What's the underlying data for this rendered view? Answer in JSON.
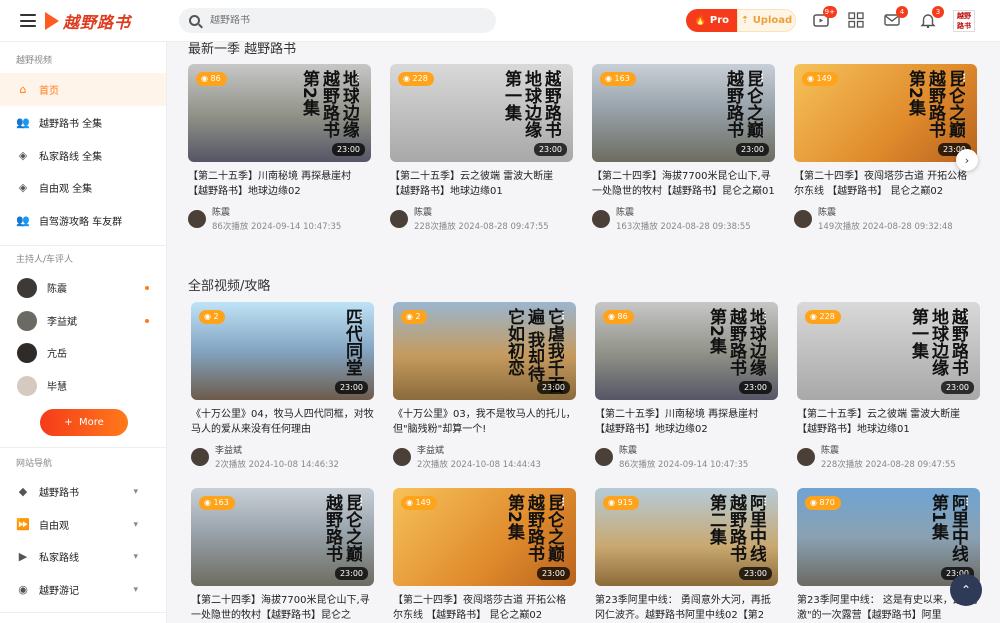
{
  "header": {
    "logo_text": "越野路书",
    "search_placeholder": "越野路书",
    "pro_label": "Pro",
    "upload_label": "Upload",
    "badges": {
      "video": "9+",
      "mail": "4",
      "bell": "3"
    },
    "avatar_text": "越野路书"
  },
  "sidebar": {
    "section1": "越野视频",
    "items": [
      {
        "label": "首页",
        "icon": "home-icon"
      },
      {
        "label": "越野路书 全集",
        "icon": "users-icon"
      },
      {
        "label": "私家路线 全集",
        "icon": "layers-icon"
      },
      {
        "label": "自由观 全集",
        "icon": "layers-icon"
      },
      {
        "label": "自驾游攻略 车友群",
        "icon": "users-icon"
      }
    ],
    "section2": "主持人/车评人",
    "hosts": [
      {
        "name": "陈震"
      },
      {
        "name": "李益斌"
      },
      {
        "name": "亢岳"
      },
      {
        "name": "毕慧"
      }
    ],
    "more_label": "More",
    "section3": "网站导航",
    "nav": [
      {
        "label": "越野路书",
        "icon": "diamond-icon"
      },
      {
        "label": "自由观",
        "icon": "forward-icon"
      },
      {
        "label": "私家路线",
        "icon": "video-icon"
      },
      {
        "label": "越野游记",
        "icon": "user-circle-icon"
      }
    ]
  },
  "main": {
    "latest_title": "最新一季 越野路书",
    "all_title": "全部视频/攻略",
    "latest": [
      {
        "title": "【第二十五季】川南秘境 再探悬崖村【越野路书】地球边缘02",
        "views": "86",
        "duration": "23:00",
        "author": "陈震",
        "stats": "86次播放 2024-09-14 10:47:35",
        "theme": "t-car",
        "overlay": "地球边缘 越野路书 第2集"
      },
      {
        "title": "【第二十五季】云之彼端 雷波大断崖【越野路书】地球边缘01",
        "views": "228",
        "duration": "23:00",
        "author": "陈震",
        "stats": "228次播放 2024-08-28 09:47:55",
        "theme": "t-grey",
        "overlay": "越野路书 地球边缘 第一集"
      },
      {
        "title": "【第二十四季】海拔7700米昆仑山下,寻一处隐世的牧村【越野路书】昆仑之巅01",
        "views": "163",
        "duration": "23:00",
        "author": "陈震",
        "stats": "163次播放 2024-08-28 09:38:55",
        "theme": "t-mtn",
        "overlay": "昆仑之巅 越野路书"
      },
      {
        "title": "【第二十四季】夜闯塔莎古道 开拓公格尔东线 【越野路书】 昆仑之巅02",
        "views": "149",
        "duration": "23:00",
        "author": "陈震",
        "stats": "149次播放 2024-08-28 09:32:48",
        "theme": "t-gold",
        "overlay": "昆仑之巅 越野路书 第2集"
      }
    ],
    "all_row1": [
      {
        "title": "《十万公里》04，牧马人四代同框，对牧马人的爱从来没有任何理由",
        "views": "2",
        "duration": "23:00",
        "author": "李益斌",
        "stats": "2次播放 2024-10-08 14:46:32",
        "theme": "t-jeep",
        "overlay": "四代同堂"
      },
      {
        "title": "《十万公里》03，我不是牧马人的托儿，但\"脑残粉\"却算一个!",
        "views": "2",
        "duration": "23:00",
        "author": "李益斌",
        "stats": "2次播放 2024-10-08 14:44:43",
        "theme": "t-desert",
        "overlay": "它虐我千百遍 我却待它如初恋"
      },
      {
        "title": "【第二十五季】川南秘境 再探悬崖村【越野路书】地球边缘02",
        "views": "86",
        "duration": "23:00",
        "author": "陈震",
        "stats": "86次播放 2024-09-14 10:47:35",
        "theme": "t-car",
        "overlay": "地球边缘 越野路书 第2集"
      },
      {
        "title": "【第二十五季】云之彼端 雷波大断崖【越野路书】地球边缘01",
        "views": "228",
        "duration": "23:00",
        "author": "陈震",
        "stats": "228次播放 2024-08-28 09:47:55",
        "theme": "t-grey",
        "overlay": "越野路书 地球边缘 第一集"
      }
    ],
    "all_row2": [
      {
        "title": "【第二十四季】海拔7700米昆仑山下,寻一处隐世的牧村【越野路书】昆仑之",
        "views": "163",
        "duration": "23:00",
        "theme": "t-mtn",
        "overlay": "昆仑之巅 越野路书"
      },
      {
        "title": "【第二十四季】夜闯塔莎古道 开拓公格尔东线 【越野路书】 昆仑之巅02",
        "views": "149",
        "duration": "23:00",
        "theme": "t-gold",
        "overlay": "昆仑之巅 越野路书 第2集"
      },
      {
        "title": "第23季阿里中线： 勇闯意外大河，再抵冈仁波齐。越野路书阿里中线02【第2",
        "views": "915",
        "duration": "23:00",
        "theme": "t-arli",
        "overlay": "阿里中线 越野路书 第二集"
      },
      {
        "title": "第23季阿里中线： 这是有史以来，最\"刺激\"的一次露营【越野路书】阿里",
        "views": "870",
        "duration": "23:00",
        "theme": "t-arli2",
        "overlay": "阿里中线 第1集"
      }
    ]
  }
}
